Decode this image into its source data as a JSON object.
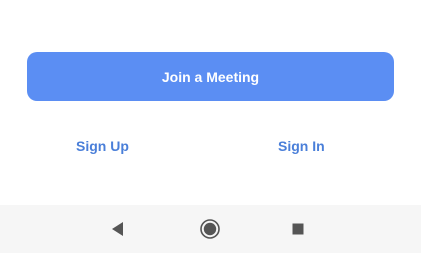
{
  "main": {
    "join_button_label": "Join a Meeting",
    "sign_up_label": "Sign Up",
    "sign_in_label": "Sign In"
  },
  "navbar": {
    "back_icon": "back-triangle-icon",
    "home_icon": "home-circle-icon",
    "recent_icon": "recent-apps-square-icon"
  },
  "colors": {
    "accent": "#5b8ef3",
    "link": "#4a7fd9",
    "nav_icon": "#555555",
    "navbar_bg": "#f6f6f6"
  }
}
